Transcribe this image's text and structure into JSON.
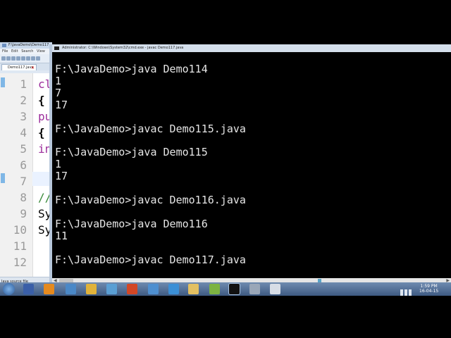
{
  "editor": {
    "window_title": "F:\\JavaDemo\\Demo117",
    "menu": [
      "File",
      "Edit",
      "Search",
      "View"
    ],
    "tab_label": "Demo117.java",
    "line_numbers": [
      "1",
      "2",
      "3",
      "4",
      "5",
      "6",
      "7",
      "8",
      "9",
      "10",
      "11",
      "12"
    ],
    "code_lines": [
      "cl",
      "{",
      "pu",
      "{",
      "in",
      "",
      "",
      "//",
      "Sy",
      "Sy",
      "",
      ""
    ],
    "status_text": "Java source file"
  },
  "console": {
    "window_title": "Administrator: C:\\Windows\\System32\\cmd.exe - javac  Demo117.java",
    "output": "F:\\JavaDemo>java Demo114\n1\n7\n17\n\nF:\\JavaDemo>javac Demo115.java\n\nF:\\JavaDemo>java Demo115\n1\n17\n\nF:\\JavaDemo>javac Demo116.java\n\nF:\\JavaDemo>java Demo116\n11\n\nF:\\JavaDemo>javac Demo117.java",
    "text_color": "#e6e6e6",
    "background_color": "#000000"
  },
  "taskbar": {
    "start_icon": "windows-start-icon",
    "apps": [
      {
        "name": "calculator-icon",
        "color": "#3a5fa8",
        "active": false
      },
      {
        "name": "media-player-icon",
        "color": "#e58a1f",
        "active": false
      },
      {
        "name": "computer-icon",
        "color": "#4a88c7",
        "active": false
      },
      {
        "name": "chrome-icon",
        "color": "#e0b23a",
        "active": false
      },
      {
        "name": "network-icon",
        "color": "#5a9fd4",
        "active": false
      },
      {
        "name": "powerpoint-icon",
        "color": "#d24726",
        "active": false
      },
      {
        "name": "photo-viewer-icon",
        "color": "#4e8fd0",
        "active": false
      },
      {
        "name": "browser-globe-icon",
        "color": "#3b8fd6",
        "active": false
      },
      {
        "name": "folder-icon",
        "color": "#e3c062",
        "active": false
      },
      {
        "name": "notepad-plus-icon",
        "color": "#7cb342",
        "active": false
      },
      {
        "name": "command-prompt-icon",
        "color": "#111111",
        "active": true
      },
      {
        "name": "tools-icon",
        "color": "#9aa7b8",
        "active": false
      },
      {
        "name": "video-player-icon",
        "color": "#d7dde6",
        "active": false
      }
    ],
    "clock_time": "1:59 PM",
    "clock_date": "16-04-15",
    "accent_color": "#4d6a93"
  }
}
